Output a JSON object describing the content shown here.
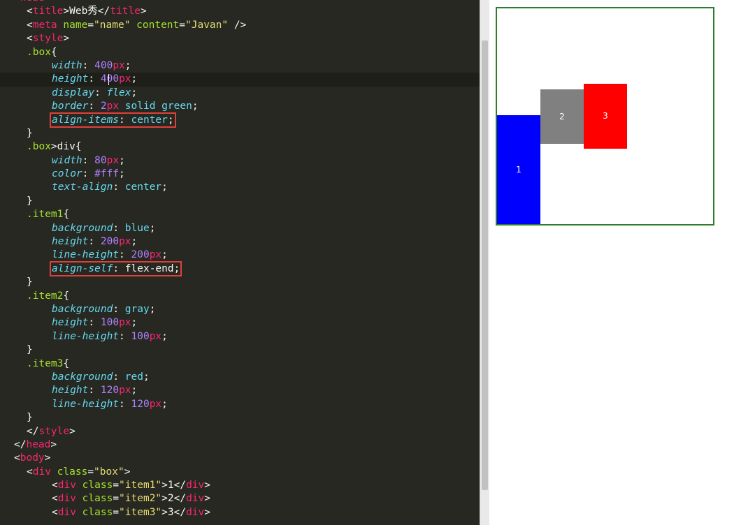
{
  "editor": {
    "lines": [
      {
        "indent": 1,
        "tokens": [
          [
            "tag",
            "<head>"
          ]
        ]
      },
      {
        "indent": 2,
        "tokens": [
          [
            "plain",
            "<"
          ],
          [
            "tag",
            "title"
          ],
          [
            "plain",
            ">Web秀</"
          ],
          [
            "tag",
            "title"
          ],
          [
            "plain",
            ">"
          ]
        ]
      },
      {
        "indent": 2,
        "tokens": [
          [
            "plain",
            "<"
          ],
          [
            "tag",
            "meta "
          ],
          [
            "attr",
            "name"
          ],
          [
            "plain",
            "="
          ],
          [
            "str",
            "\"name\" "
          ],
          [
            "attr",
            "content"
          ],
          [
            "plain",
            "="
          ],
          [
            "str",
            "\"Javan\""
          ],
          [
            "plain",
            " />"
          ]
        ]
      },
      {
        "indent": 2,
        "tokens": [
          [
            "plain",
            "<"
          ],
          [
            "tag",
            "style"
          ],
          [
            "plain",
            ">"
          ]
        ]
      },
      {
        "indent": 2,
        "tokens": [
          [
            "sel",
            ".box"
          ],
          [
            "plain",
            "{"
          ]
        ]
      },
      {
        "indent": 4,
        "tokens": [
          [
            "prop",
            "width"
          ],
          [
            "plain",
            ": "
          ],
          [
            "num",
            "400"
          ],
          [
            "unit",
            "px"
          ],
          [
            "plain",
            ";"
          ]
        ]
      },
      {
        "indent": 4,
        "current": true,
        "caret": true,
        "tokens": [
          [
            "prop",
            "height"
          ],
          [
            "plain",
            ": "
          ],
          [
            "num",
            "400"
          ],
          [
            "unit",
            "px"
          ],
          [
            "plain",
            ";"
          ]
        ]
      },
      {
        "indent": 4,
        "tokens": [
          [
            "prop",
            "display"
          ],
          [
            "plain",
            ": "
          ],
          [
            "prop",
            "flex"
          ],
          [
            "plain",
            ";"
          ]
        ]
      },
      {
        "indent": 4,
        "tokens": [
          [
            "prop",
            "border"
          ],
          [
            "plain",
            ": "
          ],
          [
            "num",
            "2"
          ],
          [
            "unit",
            "px"
          ],
          [
            "val",
            " solid green"
          ],
          [
            "plain",
            ";"
          ]
        ]
      },
      {
        "indent": 4,
        "highlight": true,
        "tokens": [
          [
            "prop",
            "align-items"
          ],
          [
            "plain",
            ": "
          ],
          [
            "val",
            "center"
          ],
          [
            "plain",
            ";"
          ]
        ]
      },
      {
        "indent": 2,
        "tokens": [
          [
            "plain",
            "}"
          ]
        ]
      },
      {
        "indent": 2,
        "tokens": [
          [
            "sel",
            ".box"
          ],
          [
            "plain",
            ">div{"
          ]
        ]
      },
      {
        "indent": 4,
        "tokens": [
          [
            "prop",
            "width"
          ],
          [
            "plain",
            ": "
          ],
          [
            "num",
            "80"
          ],
          [
            "unit",
            "px"
          ],
          [
            "plain",
            ";"
          ]
        ]
      },
      {
        "indent": 4,
        "tokens": [
          [
            "prop",
            "color"
          ],
          [
            "plain",
            ": "
          ],
          [
            "num",
            "#fff"
          ],
          [
            "plain",
            ";"
          ]
        ]
      },
      {
        "indent": 4,
        "tokens": [
          [
            "prop",
            "text-align"
          ],
          [
            "plain",
            ": "
          ],
          [
            "val",
            "center"
          ],
          [
            "plain",
            ";"
          ]
        ]
      },
      {
        "indent": 2,
        "tokens": [
          [
            "plain",
            "}"
          ]
        ]
      },
      {
        "indent": 2,
        "tokens": [
          [
            "sel",
            ".item1"
          ],
          [
            "plain",
            "{"
          ]
        ]
      },
      {
        "indent": 4,
        "tokens": [
          [
            "prop",
            "background"
          ],
          [
            "plain",
            ": "
          ],
          [
            "val",
            "blue"
          ],
          [
            "plain",
            ";"
          ]
        ]
      },
      {
        "indent": 4,
        "tokens": [
          [
            "prop",
            "height"
          ],
          [
            "plain",
            ": "
          ],
          [
            "num",
            "200"
          ],
          [
            "unit",
            "px"
          ],
          [
            "plain",
            ";"
          ]
        ]
      },
      {
        "indent": 4,
        "tokens": [
          [
            "prop",
            "line-height"
          ],
          [
            "plain",
            ": "
          ],
          [
            "num",
            "200"
          ],
          [
            "unit",
            "px"
          ],
          [
            "plain",
            ";"
          ]
        ]
      },
      {
        "indent": 4,
        "highlight": true,
        "tokens": [
          [
            "prop",
            "align-self"
          ],
          [
            "plain",
            ": flex-end;"
          ]
        ]
      },
      {
        "indent": 2,
        "tokens": [
          [
            "plain",
            "}"
          ]
        ]
      },
      {
        "indent": 2,
        "tokens": [
          [
            "sel",
            ".item2"
          ],
          [
            "plain",
            "{"
          ]
        ]
      },
      {
        "indent": 4,
        "tokens": [
          [
            "prop",
            "background"
          ],
          [
            "plain",
            ": "
          ],
          [
            "val",
            "gray"
          ],
          [
            "plain",
            ";"
          ]
        ]
      },
      {
        "indent": 4,
        "tokens": [
          [
            "prop",
            "height"
          ],
          [
            "plain",
            ": "
          ],
          [
            "num",
            "100"
          ],
          [
            "unit",
            "px"
          ],
          [
            "plain",
            ";"
          ]
        ]
      },
      {
        "indent": 4,
        "tokens": [
          [
            "prop",
            "line-height"
          ],
          [
            "plain",
            ": "
          ],
          [
            "num",
            "100"
          ],
          [
            "unit",
            "px"
          ],
          [
            "plain",
            ";"
          ]
        ]
      },
      {
        "indent": 2,
        "tokens": [
          [
            "plain",
            "}"
          ]
        ]
      },
      {
        "indent": 2,
        "tokens": [
          [
            "sel",
            ".item3"
          ],
          [
            "plain",
            "{"
          ]
        ]
      },
      {
        "indent": 4,
        "tokens": [
          [
            "prop",
            "background"
          ],
          [
            "plain",
            ": "
          ],
          [
            "val",
            "red"
          ],
          [
            "plain",
            ";"
          ]
        ]
      },
      {
        "indent": 4,
        "tokens": [
          [
            "prop",
            "height"
          ],
          [
            "plain",
            ": "
          ],
          [
            "num",
            "120"
          ],
          [
            "unit",
            "px"
          ],
          [
            "plain",
            ";"
          ]
        ]
      },
      {
        "indent": 4,
        "tokens": [
          [
            "prop",
            "line-height"
          ],
          [
            "plain",
            ": "
          ],
          [
            "num",
            "120"
          ],
          [
            "unit",
            "px"
          ],
          [
            "plain",
            ";"
          ]
        ]
      },
      {
        "indent": 2,
        "tokens": [
          [
            "plain",
            "}"
          ]
        ]
      },
      {
        "indent": 2,
        "tokens": [
          [
            "plain",
            "</"
          ],
          [
            "tag",
            "style"
          ],
          [
            "plain",
            ">"
          ]
        ]
      },
      {
        "indent": 1,
        "tokens": [
          [
            "plain",
            "</"
          ],
          [
            "tag",
            "head"
          ],
          [
            "plain",
            ">"
          ]
        ]
      },
      {
        "indent": 1,
        "tokens": [
          [
            "plain",
            "<"
          ],
          [
            "tag",
            "body"
          ],
          [
            "plain",
            ">"
          ]
        ]
      },
      {
        "indent": 2,
        "tokens": [
          [
            "plain",
            "<"
          ],
          [
            "tag",
            "div "
          ],
          [
            "attr",
            "class"
          ],
          [
            "plain",
            "="
          ],
          [
            "str",
            "\"box\""
          ],
          [
            "plain",
            ">"
          ]
        ]
      },
      {
        "indent": 4,
        "tokens": [
          [
            "plain",
            "<"
          ],
          [
            "tag",
            "div "
          ],
          [
            "attr",
            "class"
          ],
          [
            "plain",
            "="
          ],
          [
            "str",
            "\"item1\""
          ],
          [
            "plain",
            ">1</"
          ],
          [
            "tag",
            "div"
          ],
          [
            "plain",
            ">"
          ]
        ]
      },
      {
        "indent": 4,
        "tokens": [
          [
            "plain",
            "<"
          ],
          [
            "tag",
            "div "
          ],
          [
            "attr",
            "class"
          ],
          [
            "plain",
            "="
          ],
          [
            "str",
            "\"item2\""
          ],
          [
            "plain",
            ">2</"
          ],
          [
            "tag",
            "div"
          ],
          [
            "plain",
            ">"
          ]
        ]
      },
      {
        "indent": 4,
        "tokens": [
          [
            "plain",
            "<"
          ],
          [
            "tag",
            "div "
          ],
          [
            "attr",
            "class"
          ],
          [
            "plain",
            "="
          ],
          [
            "str",
            "\"item3\""
          ],
          [
            "plain",
            ">3</"
          ],
          [
            "tag",
            "div"
          ],
          [
            "plain",
            ">"
          ]
        ]
      }
    ]
  },
  "preview": {
    "border_color": "#2e7d2e",
    "items": [
      {
        "label": "1",
        "color": "#0000ff"
      },
      {
        "label": "2",
        "color": "#808080"
      },
      {
        "label": "3",
        "color": "#ff0000"
      }
    ]
  }
}
